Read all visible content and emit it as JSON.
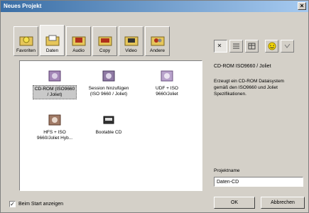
{
  "window": {
    "title": "Neues Projekt"
  },
  "tabs": [
    {
      "label": "Favoriten",
      "icon": "favorites-folder-icon"
    },
    {
      "label": "Daten",
      "icon": "data-folder-icon"
    },
    {
      "label": "Audio",
      "icon": "audio-folder-icon"
    },
    {
      "label": "Copy",
      "icon": "copy-folder-icon"
    },
    {
      "label": "Video",
      "icon": "video-folder-icon"
    },
    {
      "label": "Andere",
      "icon": "other-folder-icon"
    }
  ],
  "active_tab": "Daten",
  "items": [
    {
      "label_line1": "CD-ROM (ISO9660",
      "label_line2": "/ Joliet)",
      "icon": "cdrom-iso-icon",
      "selected": true
    },
    {
      "label_line1": "Session hinzufügen",
      "label_line2": "(ISO 9660 / Joliet)",
      "icon": "add-session-icon",
      "selected": false
    },
    {
      "label_line1": "UDF + ISO",
      "label_line2": "9660/Joliet",
      "icon": "udf-iso-icon",
      "selected": false
    },
    {
      "label_line1": "HFS + ISO",
      "label_line2": "9660/Joliet Hyb...",
      "icon": "hfs-iso-icon",
      "selected": false
    },
    {
      "label_line1": "Bootable CD",
      "label_line2": "",
      "icon": "bootable-cd-icon",
      "selected": false
    }
  ],
  "view_buttons": [
    "small-icons-view",
    "list-view",
    "details-view",
    "wizard-smiley",
    "info"
  ],
  "description": {
    "title": "CD-ROM ISO9660 / Joliet",
    "text": "Erzeugt ein CD-ROM Dataisystem gemäß den ISO9660 und Joliet Spezifikationen."
  },
  "project_name": {
    "label": "Projektname",
    "value": "Daten-CD"
  },
  "checkbox": {
    "label": "Beim Start anzeigen",
    "checked": true
  },
  "buttons": {
    "ok": "OK",
    "cancel": "Abbrechen"
  }
}
